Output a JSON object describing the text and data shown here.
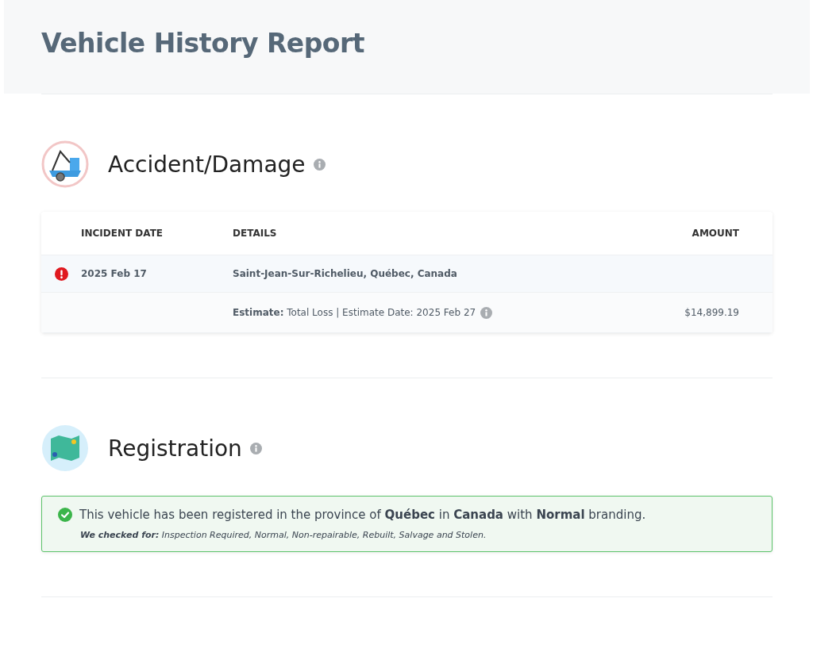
{
  "page_title": "Vehicle History Report",
  "accident": {
    "heading": "Accident/Damage",
    "columns": [
      "INCIDENT DATE",
      "DETAILS",
      "AMOUNT"
    ],
    "rows": [
      {
        "kind": "incident",
        "flagged": true,
        "date": "2025 Feb 17",
        "details": "Saint-Jean-Sur-Richelieu, Québec, Canada"
      },
      {
        "kind": "estimate",
        "flagged": false,
        "details": "**Estimate:** Total Loss | Estimate Date: 2025 Feb 27",
        "amount": "$14,899.19"
      }
    ]
  },
  "registration": {
    "heading": "Registration",
    "alert": {
      "message": "This vehicle has been registered in the province of **Québec** in **Canada** with **Normal** branding.",
      "note": "**We checked for:** Inspection Required, Normal, Non-repairable, Rebuilt, Salvage and Stolen."
    }
  }
}
